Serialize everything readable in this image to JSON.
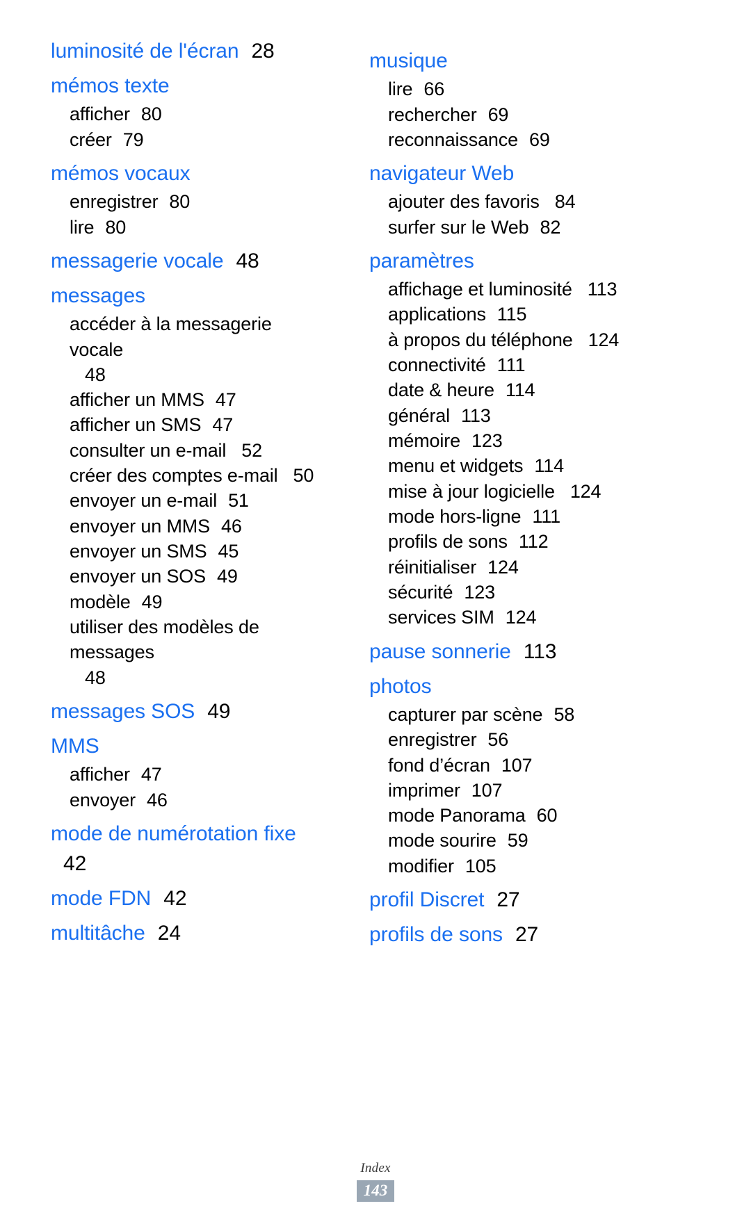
{
  "document": {
    "language": "fr",
    "accent_color": "#1a6ff0",
    "body_color": "#000000",
    "badge_color": "#9aa7b4"
  },
  "footer": {
    "label": "Index",
    "page_number": "143"
  },
  "index": {
    "left_column": [
      {
        "term": "luminosité de l'écran",
        "page": "28",
        "entries": []
      },
      {
        "term": "mémos texte",
        "page": "",
        "entries": [
          {
            "term": "afficher",
            "page": "80"
          },
          {
            "term": "créer",
            "page": "79"
          }
        ]
      },
      {
        "term": "mémos vocaux",
        "page": "",
        "entries": [
          {
            "term": "enregistrer",
            "page": "80"
          },
          {
            "term": "lire",
            "page": "80"
          }
        ]
      },
      {
        "term": "messagerie vocale",
        "page": "48",
        "entries": []
      },
      {
        "term": "messages",
        "page": "",
        "entries": [
          {
            "term": "accéder à la messagerie vocale",
            "page": "48"
          },
          {
            "term": "afficher un MMS",
            "page": "47"
          },
          {
            "term": "afficher un SMS",
            "page": "47"
          },
          {
            "term": "consulter un e-mail",
            "page": "52"
          },
          {
            "term": "créer des comptes e-mail",
            "page": "50"
          },
          {
            "term": "envoyer un e-mail",
            "page": "51"
          },
          {
            "term": "envoyer un MMS",
            "page": "46"
          },
          {
            "term": "envoyer un SMS",
            "page": "45"
          },
          {
            "term": "envoyer un SOS",
            "page": "49"
          },
          {
            "term": "modèle",
            "page": "49"
          },
          {
            "term": "utiliser des modèles de messages",
            "page": "48"
          }
        ]
      },
      {
        "term": "messages SOS",
        "page": "49",
        "entries": []
      },
      {
        "term": "MMS",
        "page": "",
        "entries": [
          {
            "term": "afficher",
            "page": "47"
          },
          {
            "term": "envoyer",
            "page": "46"
          }
        ]
      },
      {
        "term": "mode de numérotation fixe",
        "page": "42",
        "entries": []
      },
      {
        "term": "mode FDN",
        "page": "42",
        "entries": []
      },
      {
        "term": "multitâche",
        "page": "24",
        "entries": []
      }
    ],
    "right_column": [
      {
        "term": "musique",
        "page": "",
        "entries": [
          {
            "term": "lire",
            "page": "66"
          },
          {
            "term": "rechercher",
            "page": "69"
          },
          {
            "term": "reconnaissance",
            "page": "69"
          }
        ]
      },
      {
        "term": "navigateur Web",
        "page": "",
        "entries": [
          {
            "term": "ajouter des favoris",
            "page": "84"
          },
          {
            "term": "surfer sur le Web",
            "page": "82"
          }
        ]
      },
      {
        "term": "paramètres",
        "page": "",
        "entries": [
          {
            "term": "affichage et luminosité",
            "page": "113"
          },
          {
            "term": "applications",
            "page": "115"
          },
          {
            "term": "à propos du téléphone",
            "page": "124"
          },
          {
            "term": "connectivité",
            "page": "111"
          },
          {
            "term": "date & heure",
            "page": "114"
          },
          {
            "term": "général",
            "page": "113"
          },
          {
            "term": "mémoire",
            "page": "123"
          },
          {
            "term": "menu et widgets",
            "page": "114"
          },
          {
            "term": "mise à jour logicielle",
            "page": "124"
          },
          {
            "term": "mode hors-ligne",
            "page": "111"
          },
          {
            "term": "profils de sons",
            "page": "112"
          },
          {
            "term": "réinitialiser",
            "page": "124"
          },
          {
            "term": "sécurité",
            "page": "123"
          },
          {
            "term": "services SIM",
            "page": "124"
          }
        ]
      },
      {
        "term": "pause sonnerie",
        "page": "113",
        "entries": []
      },
      {
        "term": "photos",
        "page": "",
        "entries": [
          {
            "term": "capturer par scène",
            "page": "58"
          },
          {
            "term": "enregistrer",
            "page": "56"
          },
          {
            "term": "fond d’écran",
            "page": "107"
          },
          {
            "term": "imprimer",
            "page": "107"
          },
          {
            "term": "mode Panorama",
            "page": "60"
          },
          {
            "term": "mode sourire",
            "page": "59"
          },
          {
            "term": "modifier",
            "page": "105"
          }
        ]
      },
      {
        "term": "profil Discret",
        "page": "27",
        "entries": []
      },
      {
        "term": "profils de sons",
        "page": "27",
        "entries": []
      }
    ]
  }
}
